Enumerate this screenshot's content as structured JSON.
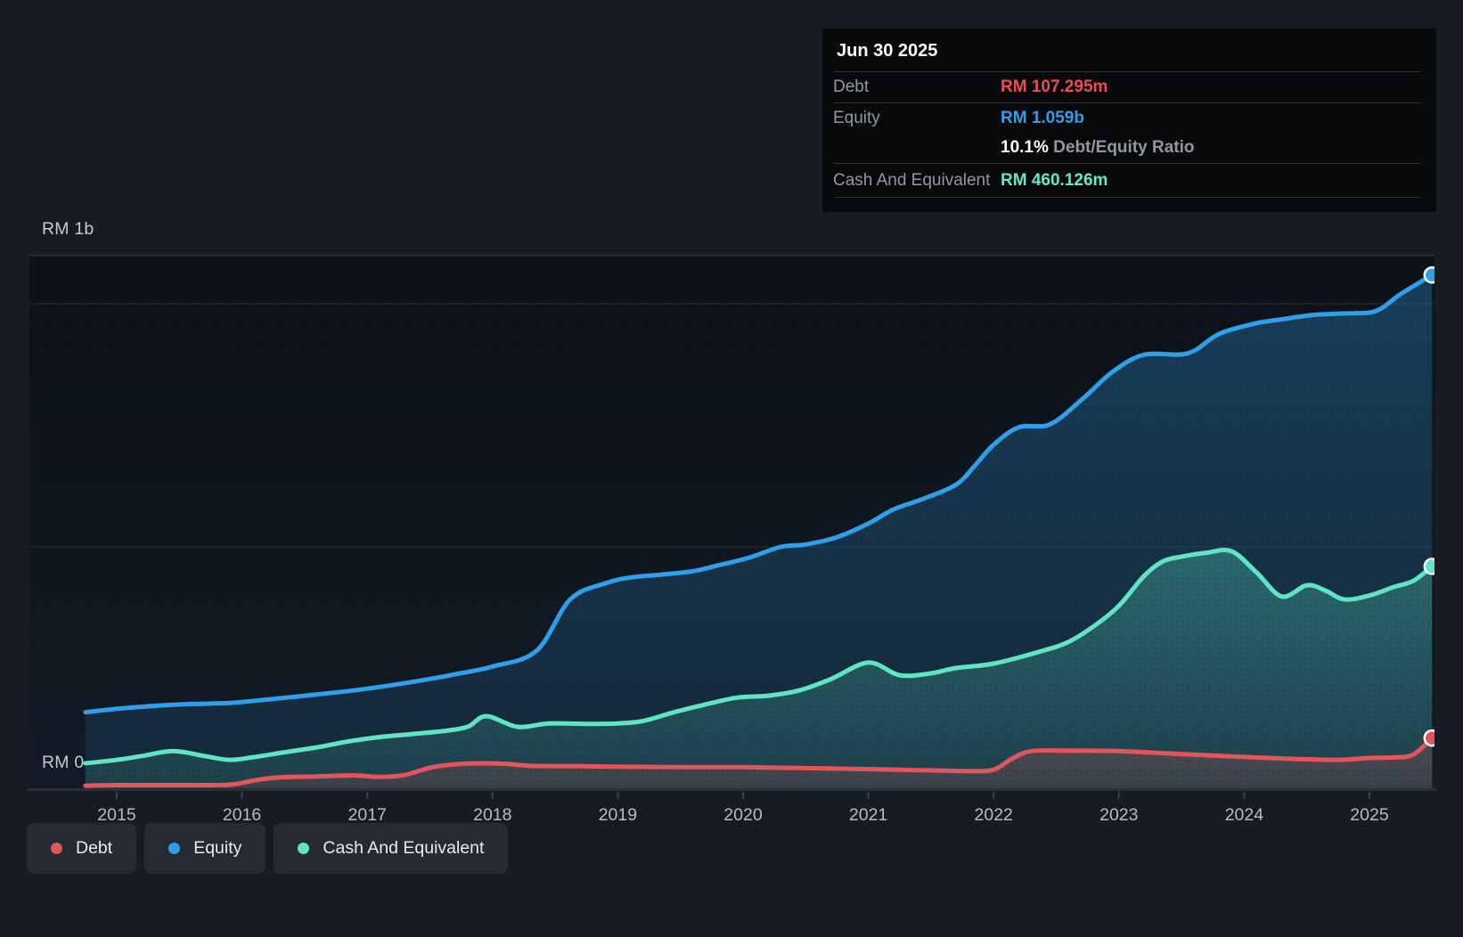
{
  "colors": {
    "page_bg": "#171b22",
    "plot_bg_top": "#0d1118",
    "plot_bg_bottom": "#121b26",
    "gridline": "#2f343d",
    "axis_line": "#2a2e35",
    "debt": "#e4555b",
    "equity": "#2e9fe8",
    "cash": "#5fe5c3",
    "tooltip_bg": "#08090b",
    "debt_value_text": "#f04b51",
    "equity_value_text": "#2e9fe8",
    "cash_value_text": "#63e8c8"
  },
  "axis": {
    "y_top_label": "RM 1b",
    "y_zero_label": "RM 0",
    "years": [
      "2015",
      "2016",
      "2017",
      "2018",
      "2019",
      "2020",
      "2021",
      "2022",
      "2023",
      "2024",
      "2025"
    ]
  },
  "tooltip": {
    "date": "Jun 30 2025",
    "rows": [
      {
        "kind": "value",
        "label": "Debt",
        "value": "RM 107.295m",
        "color_key": "debt_value_text"
      },
      {
        "kind": "value",
        "label": "Equity",
        "value": "RM 1.059b",
        "color_key": "equity_value_text"
      },
      {
        "kind": "ratio",
        "label": "",
        "bold": "10.1%",
        "rest": "Debt/Equity Ratio"
      },
      {
        "kind": "value",
        "label": "Cash And Equivalent",
        "value": "RM 460.126m",
        "color_key": "cash_value_text"
      }
    ]
  },
  "legend": [
    {
      "label": "Debt",
      "color_key": "debt"
    },
    {
      "label": "Equity",
      "color_key": "equity"
    },
    {
      "label": "Cash And Equivalent",
      "color_key": "cash"
    }
  ],
  "chart_data": {
    "type": "area",
    "title": "Debt, Equity and Cash history (RM millions)",
    "x_unit": "decimal year",
    "x_range": [
      2014.75,
      2025.5
    ],
    "ylim_m": [
      0,
      1100
    ],
    "gridlines_m": [
      0,
      500,
      1000
    ],
    "grid": true,
    "legend_position": "bottom-left",
    "series": [
      {
        "name": "Equity",
        "color_key": "equity",
        "end_value_label": "RM 1.059b",
        "points": [
          [
            2014.75,
            160
          ],
          [
            2015.0,
            167
          ],
          [
            2015.3,
            173
          ],
          [
            2015.6,
            177
          ],
          [
            2015.9,
            179
          ],
          [
            2016.2,
            186
          ],
          [
            2016.5,
            194
          ],
          [
            2016.8,
            202
          ],
          [
            2017.1,
            212
          ],
          [
            2017.4,
            224
          ],
          [
            2017.7,
            238
          ],
          [
            2018.0,
            254
          ],
          [
            2018.35,
            286
          ],
          [
            2018.62,
            392
          ],
          [
            2018.9,
            425
          ],
          [
            2019.1,
            437
          ],
          [
            2019.35,
            443
          ],
          [
            2019.6,
            450
          ],
          [
            2019.8,
            462
          ],
          [
            2020.05,
            478
          ],
          [
            2020.3,
            500
          ],
          [
            2020.5,
            505
          ],
          [
            2020.75,
            520
          ],
          [
            2021.0,
            548
          ],
          [
            2021.2,
            577
          ],
          [
            2021.45,
            600
          ],
          [
            2021.7,
            628
          ],
          [
            2021.85,
            667
          ],
          [
            2022.0,
            710
          ],
          [
            2022.2,
            746
          ],
          [
            2022.45,
            752
          ],
          [
            2022.7,
            802
          ],
          [
            2022.95,
            860
          ],
          [
            2023.2,
            895
          ],
          [
            2023.55,
            898
          ],
          [
            2023.8,
            938
          ],
          [
            2024.1,
            960
          ],
          [
            2024.3,
            968
          ],
          [
            2024.55,
            977
          ],
          [
            2024.8,
            980
          ],
          [
            2025.05,
            985
          ],
          [
            2025.25,
            1020
          ],
          [
            2025.5,
            1059
          ]
        ]
      },
      {
        "name": "Cash And Equivalent",
        "color_key": "cash",
        "end_value_label": "RM 460.126m",
        "points": [
          [
            2014.75,
            55
          ],
          [
            2015.0,
            62
          ],
          [
            2015.2,
            70
          ],
          [
            2015.45,
            80
          ],
          [
            2015.7,
            70
          ],
          [
            2015.9,
            62
          ],
          [
            2016.1,
            68
          ],
          [
            2016.35,
            78
          ],
          [
            2016.6,
            88
          ],
          [
            2016.85,
            100
          ],
          [
            2017.1,
            109
          ],
          [
            2017.35,
            115
          ],
          [
            2017.6,
            121
          ],
          [
            2017.8,
            130
          ],
          [
            2017.95,
            152
          ],
          [
            2018.2,
            130
          ],
          [
            2018.45,
            137
          ],
          [
            2018.75,
            136
          ],
          [
            2019.0,
            137
          ],
          [
            2019.2,
            142
          ],
          [
            2019.45,
            160
          ],
          [
            2019.7,
            176
          ],
          [
            2019.95,
            190
          ],
          [
            2020.2,
            194
          ],
          [
            2020.45,
            205
          ],
          [
            2020.7,
            228
          ],
          [
            2021.0,
            262
          ],
          [
            2021.25,
            236
          ],
          [
            2021.5,
            240
          ],
          [
            2021.7,
            251
          ],
          [
            2022.0,
            260
          ],
          [
            2022.4,
            287
          ],
          [
            2022.6,
            305
          ],
          [
            2022.8,
            337
          ],
          [
            2023.0,
            379
          ],
          [
            2023.2,
            440
          ],
          [
            2023.35,
            470
          ],
          [
            2023.5,
            480
          ],
          [
            2023.7,
            488
          ],
          [
            2023.9,
            491
          ],
          [
            2024.1,
            447
          ],
          [
            2024.3,
            398
          ],
          [
            2024.5,
            421
          ],
          [
            2024.65,
            410
          ],
          [
            2024.8,
            392
          ],
          [
            2025.0,
            400
          ],
          [
            2025.2,
            418
          ],
          [
            2025.35,
            430
          ],
          [
            2025.5,
            460
          ]
        ]
      },
      {
        "name": "Debt",
        "color_key": "debt",
        "end_value_label": "RM 107.295m",
        "points": [
          [
            2014.75,
            9
          ],
          [
            2015.0,
            10
          ],
          [
            2015.5,
            10
          ],
          [
            2015.9,
            11
          ],
          [
            2016.1,
            20
          ],
          [
            2016.3,
            26
          ],
          [
            2016.6,
            28
          ],
          [
            2016.9,
            30
          ],
          [
            2017.1,
            27
          ],
          [
            2017.3,
            31
          ],
          [
            2017.5,
            46
          ],
          [
            2017.7,
            53
          ],
          [
            2017.9,
            55
          ],
          [
            2018.1,
            54
          ],
          [
            2018.3,
            50
          ],
          [
            2018.7,
            49
          ],
          [
            2019.0,
            48
          ],
          [
            2019.5,
            47
          ],
          [
            2020.0,
            47
          ],
          [
            2020.5,
            45
          ],
          [
            2021.0,
            43
          ],
          [
            2021.4,
            41
          ],
          [
            2021.8,
            39
          ],
          [
            2022.0,
            42
          ],
          [
            2022.15,
            65
          ],
          [
            2022.3,
            80
          ],
          [
            2022.6,
            81
          ],
          [
            2023.0,
            80
          ],
          [
            2023.5,
            74
          ],
          [
            2024.0,
            68
          ],
          [
            2024.4,
            64
          ],
          [
            2024.75,
            62
          ],
          [
            2025.0,
            66
          ],
          [
            2025.2,
            67
          ],
          [
            2025.35,
            73
          ],
          [
            2025.5,
            107
          ]
        ]
      }
    ]
  }
}
